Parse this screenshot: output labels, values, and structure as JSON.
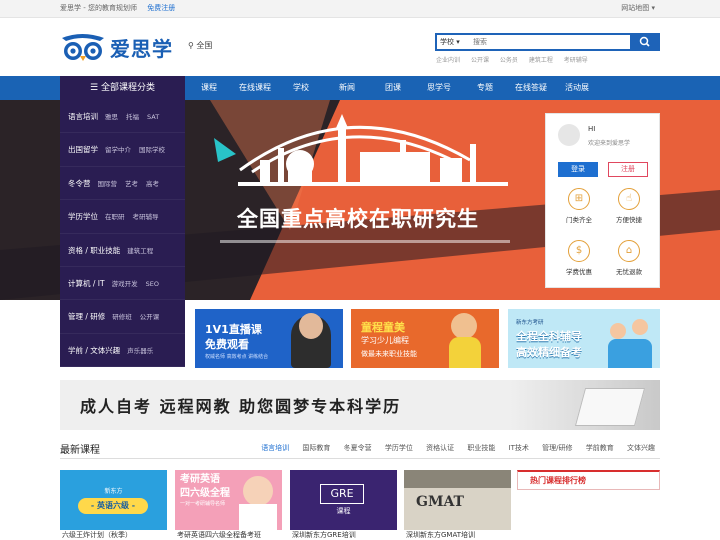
{
  "topbar": {
    "slogan": "爱思学 - 您的教育规划师",
    "register": "免费注册",
    "sitemap": "网站地图 ▾"
  },
  "header": {
    "logo_text": "爱思学",
    "city": "全国",
    "search": {
      "scope": "学校 ▾",
      "placeholder": "搜索"
    },
    "hotwords": [
      "企业内训",
      "公开课",
      "公务员",
      "建筑工程",
      "考研辅导"
    ]
  },
  "nav": {
    "all_label": "全部课程分类",
    "items": [
      "课程",
      "在线课程",
      "学校",
      "新闻",
      "团课",
      "思学号",
      "专题",
      "在线答疑",
      "活动展"
    ]
  },
  "sidebar": [
    {
      "cat": "语言培训",
      "subs": [
        "雅思",
        "托福",
        "SAT"
      ]
    },
    {
      "cat": "出国留学",
      "subs": [
        "留学中介",
        "国际学校"
      ]
    },
    {
      "cat": "冬令营",
      "subs": [
        "国际营",
        "艺考",
        "高考"
      ]
    },
    {
      "cat": "学历学位",
      "subs": [
        "在职研",
        "考研辅导"
      ]
    },
    {
      "cat": "资格 / 职业技能",
      "subs": [
        "建筑工程"
      ]
    },
    {
      "cat": "计算机 / IT",
      "subs": [
        "游戏开发",
        "SEO"
      ]
    },
    {
      "cat": "管理 / 研修",
      "subs": [
        "研修班",
        "公开课"
      ]
    },
    {
      "cat": "学前 / 文体兴趣",
      "subs": [
        "声乐器乐"
      ]
    }
  ],
  "banner": {
    "headline": "全国重点高校在职研究生"
  },
  "user": {
    "hi": "HI",
    "welcome": "欢迎来到爱思学",
    "login": "登录",
    "register": "注册",
    "features": [
      "门类齐全",
      "方便快捷",
      "学费优惠",
      "无忧退款"
    ]
  },
  "promos": [
    {
      "line1": "1V1直播课",
      "line2": "免费观看",
      "sub": "权威名师 高效考点 讲练结合"
    },
    {
      "line1": "童程童美",
      "line2": "学习少儿编程",
      "sub": "做最未来职业技能"
    },
    {
      "brand": "新东方考研",
      "line1": "全程全科辅导",
      "line2": "高效精细备考"
    }
  ],
  "wide_banner": {
    "text": "成人自考  远程网教  助您圆梦专本科学历"
  },
  "latest": {
    "title": "最新课程",
    "tabs": [
      "语言培训",
      "国际教育",
      "冬夏令营",
      "学历学位",
      "资格认证",
      "职业技能",
      "IT技术",
      "管理/研修",
      "学前教育",
      "文体兴趣"
    ],
    "active": "语言培训"
  },
  "cards": [
    {
      "brand": "新东方",
      "label": "- 英语六级 -",
      "caption": "六级王炸计划（秋季）"
    },
    {
      "line1": "考研英语",
      "line2": "四六级全程",
      "sub": "一对一考研辅导名师",
      "caption": "考研英语四六级全程备考班"
    },
    {
      "label": "GRE",
      "sub": "课程",
      "caption": "深圳新东方GRE培训"
    },
    {
      "label": "GMAT",
      "caption": "深圳新东方GMAT培训"
    }
  ],
  "ranking": {
    "title": "热门课程排行榜"
  },
  "colors": {
    "brand_blue": "#1a63b4",
    "sidebar_purple": "#2a1d52",
    "banner_orange": "#e8603a",
    "rank_red": "#d82e2e"
  }
}
